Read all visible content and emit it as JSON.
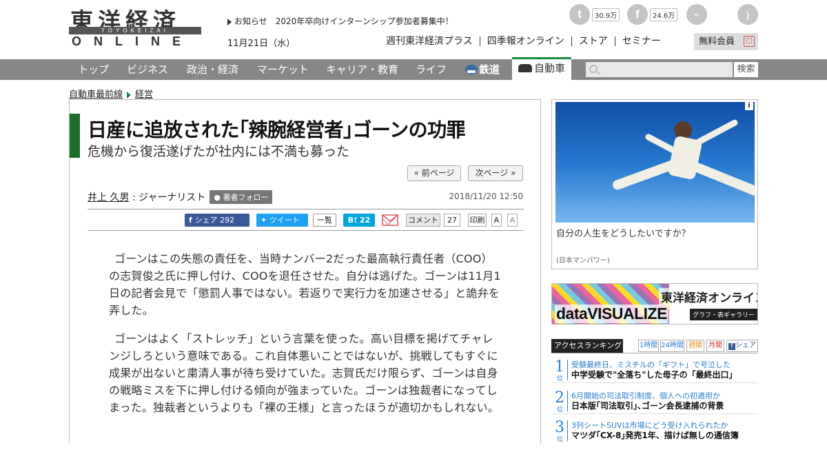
{
  "header": {
    "logo_jp": "東洋経済",
    "logo_sub": "TOYOKEIZAI",
    "logo_online": "ONLINE",
    "news_label": "お知らせ",
    "news_text": "2020年卒向けインターンシップ参加者募集中！",
    "date": "11月21日（水）",
    "links": [
      "週刊東洋経済プラス",
      "四季報オンライン",
      "ストア",
      "セミナー"
    ],
    "member_button": "無料会員",
    "social": {
      "twitter_count": "30.9万",
      "facebook_count": "24.6万"
    }
  },
  "nav": {
    "items": [
      "トップ",
      "ビジネス",
      "政治・経済",
      "マーケット",
      "キャリア・教育",
      "ライフ",
      "鉄道",
      "自動車"
    ],
    "active": "自動車",
    "search_button": "検索"
  },
  "breadcrumb": [
    "自動車最前線",
    "経営"
  ],
  "article": {
    "title": "日産に追放された｢辣腕経営者｣ゴーンの功罪",
    "subtitle": "危機から復活遂げたが社内には不満も募った",
    "prev_page": "« 前ページ",
    "next_page": "次ページ »",
    "author_name": "井上 久男",
    "author_role": " : ジャーナリスト",
    "follow_label": "著者フォロー",
    "published": "2018/11/20 12:50",
    "share": {
      "facebook": "シェア",
      "facebook_count": "292",
      "tweet": "ツイート",
      "list": "一覧",
      "hatena": "B! 22",
      "comment": "コメント",
      "comment_count": "27",
      "print": "印刷",
      "font_large": "A",
      "font_small": "A"
    },
    "paragraphs": [
      "ゴーンはこの失態の責任を、当時ナンバー2だった最高執行責任者（COO）の志賀俊之氏に押し付け、COOを退任させた。自分は逃げた。ゴーンは11月1日の記者会見で「懲罰人事ではない。若返りで実行力を加速させる」と詭弁を弄した。",
      "ゴーンはよく「ストレッチ」という言葉を使った。高い目標を掲げてチャレンジしろという意味である。これ自体悪いことではないが、挑戦してもすぐに成果が出ないと粛清人事が待ち受けていた。志賀氏だけ限らず、ゴーンは自身の戦略ミスを下に押し付ける傾向が強まっていた。ゴーンは独裁者になってしまった。独裁者というよりも「裸の王様」と言ったほうが適切かもしれない。"
    ]
  },
  "sidebar": {
    "ad_caption": "自分の人生をどうしたいですか？",
    "ad_source": "(日本マンパワー)",
    "ad_info": "i",
    "dataviz_jp": "東洋経済オンライン",
    "dataviz_en": "dataVISUALIZE",
    "dataviz_tag": "グラフ・表ギャラリー",
    "ranking_title": "アクセスランキング",
    "ranking_tabs": [
      "1時間",
      "24時間",
      "週間",
      "月間",
      "シェア"
    ],
    "ranking_unit": "位",
    "ranking": [
      {
        "rank": "1",
        "sub": "受験最終日、ミスチルの「ギフト」で号泣した",
        "title": "中学受験で\"全落ち\"した母子の「最終出口」"
      },
      {
        "rank": "2",
        "sub": "6月開始の司法取引制度、個人への初適用か",
        "title": "日本版｢司法取引｣､ゴーン会長逮捕の背景"
      },
      {
        "rank": "3",
        "sub": "3列シートSUVは市場にどう受け入れられたか",
        "title": "マツダ｢CX-8｣発売1年、描けば無しの通信簿"
      }
    ]
  },
  "colors": {
    "nav_bg": "#878787",
    "accent_green": "#1a6e2a",
    "facebook": "#3b5998",
    "twitter": "#1da1f2",
    "hatena": "#00a4de",
    "rank_blue": "#2a7cd2"
  }
}
